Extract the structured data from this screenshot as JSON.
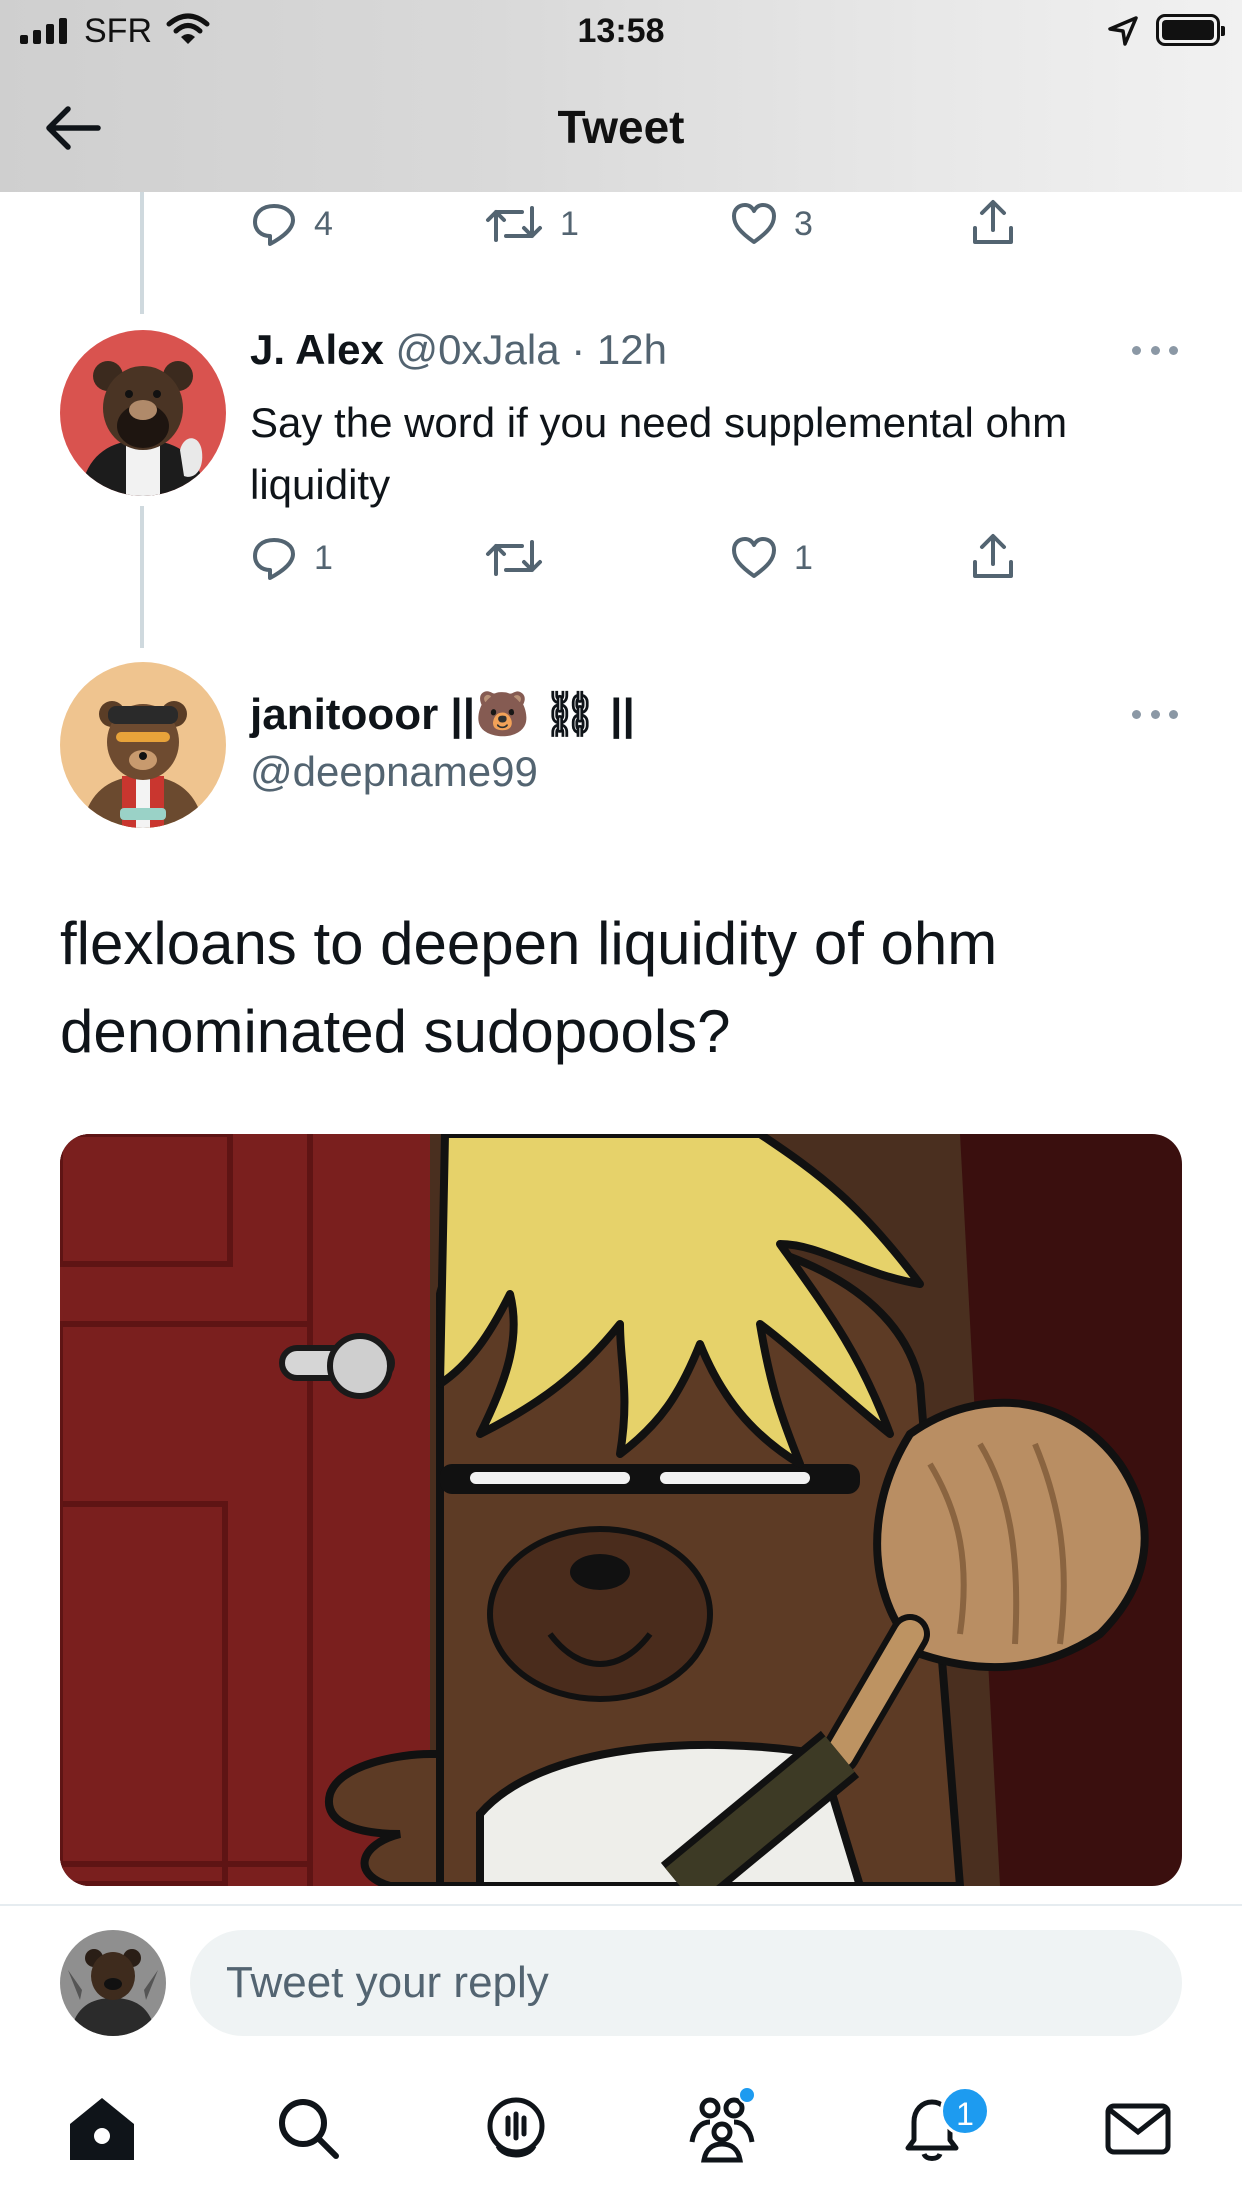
{
  "status_bar": {
    "carrier": "SFR",
    "time": "13:58"
  },
  "header": {
    "title": "Tweet"
  },
  "previous_tweet_actions": {
    "replies": "4",
    "retweets": "1",
    "likes": "3"
  },
  "reply_tweet": {
    "name": "J. Alex",
    "handle": "@0xJala",
    "time": "· 12h",
    "text": "Say the word if you need supplemental ohm liquidity",
    "replies": "1",
    "retweets": "",
    "likes": "1"
  },
  "main_tweet": {
    "name": "janitooor ||🐻 ⛓ ||",
    "handle": "@deepname99",
    "text": "flexloans to deepen liquidity of ohm denominated sudopools?"
  },
  "reply_input": {
    "placeholder": "Tweet your reply"
  },
  "tab_bar": {
    "notifications_badge": "1",
    "items": [
      "home-icon",
      "search-icon",
      "spaces-icon",
      "communities-icon",
      "notifications-icon",
      "messages-icon"
    ]
  },
  "colors": {
    "accent": "#1d9bf0",
    "secondary_text": "#536471",
    "thread_line": "#cfd9de"
  }
}
